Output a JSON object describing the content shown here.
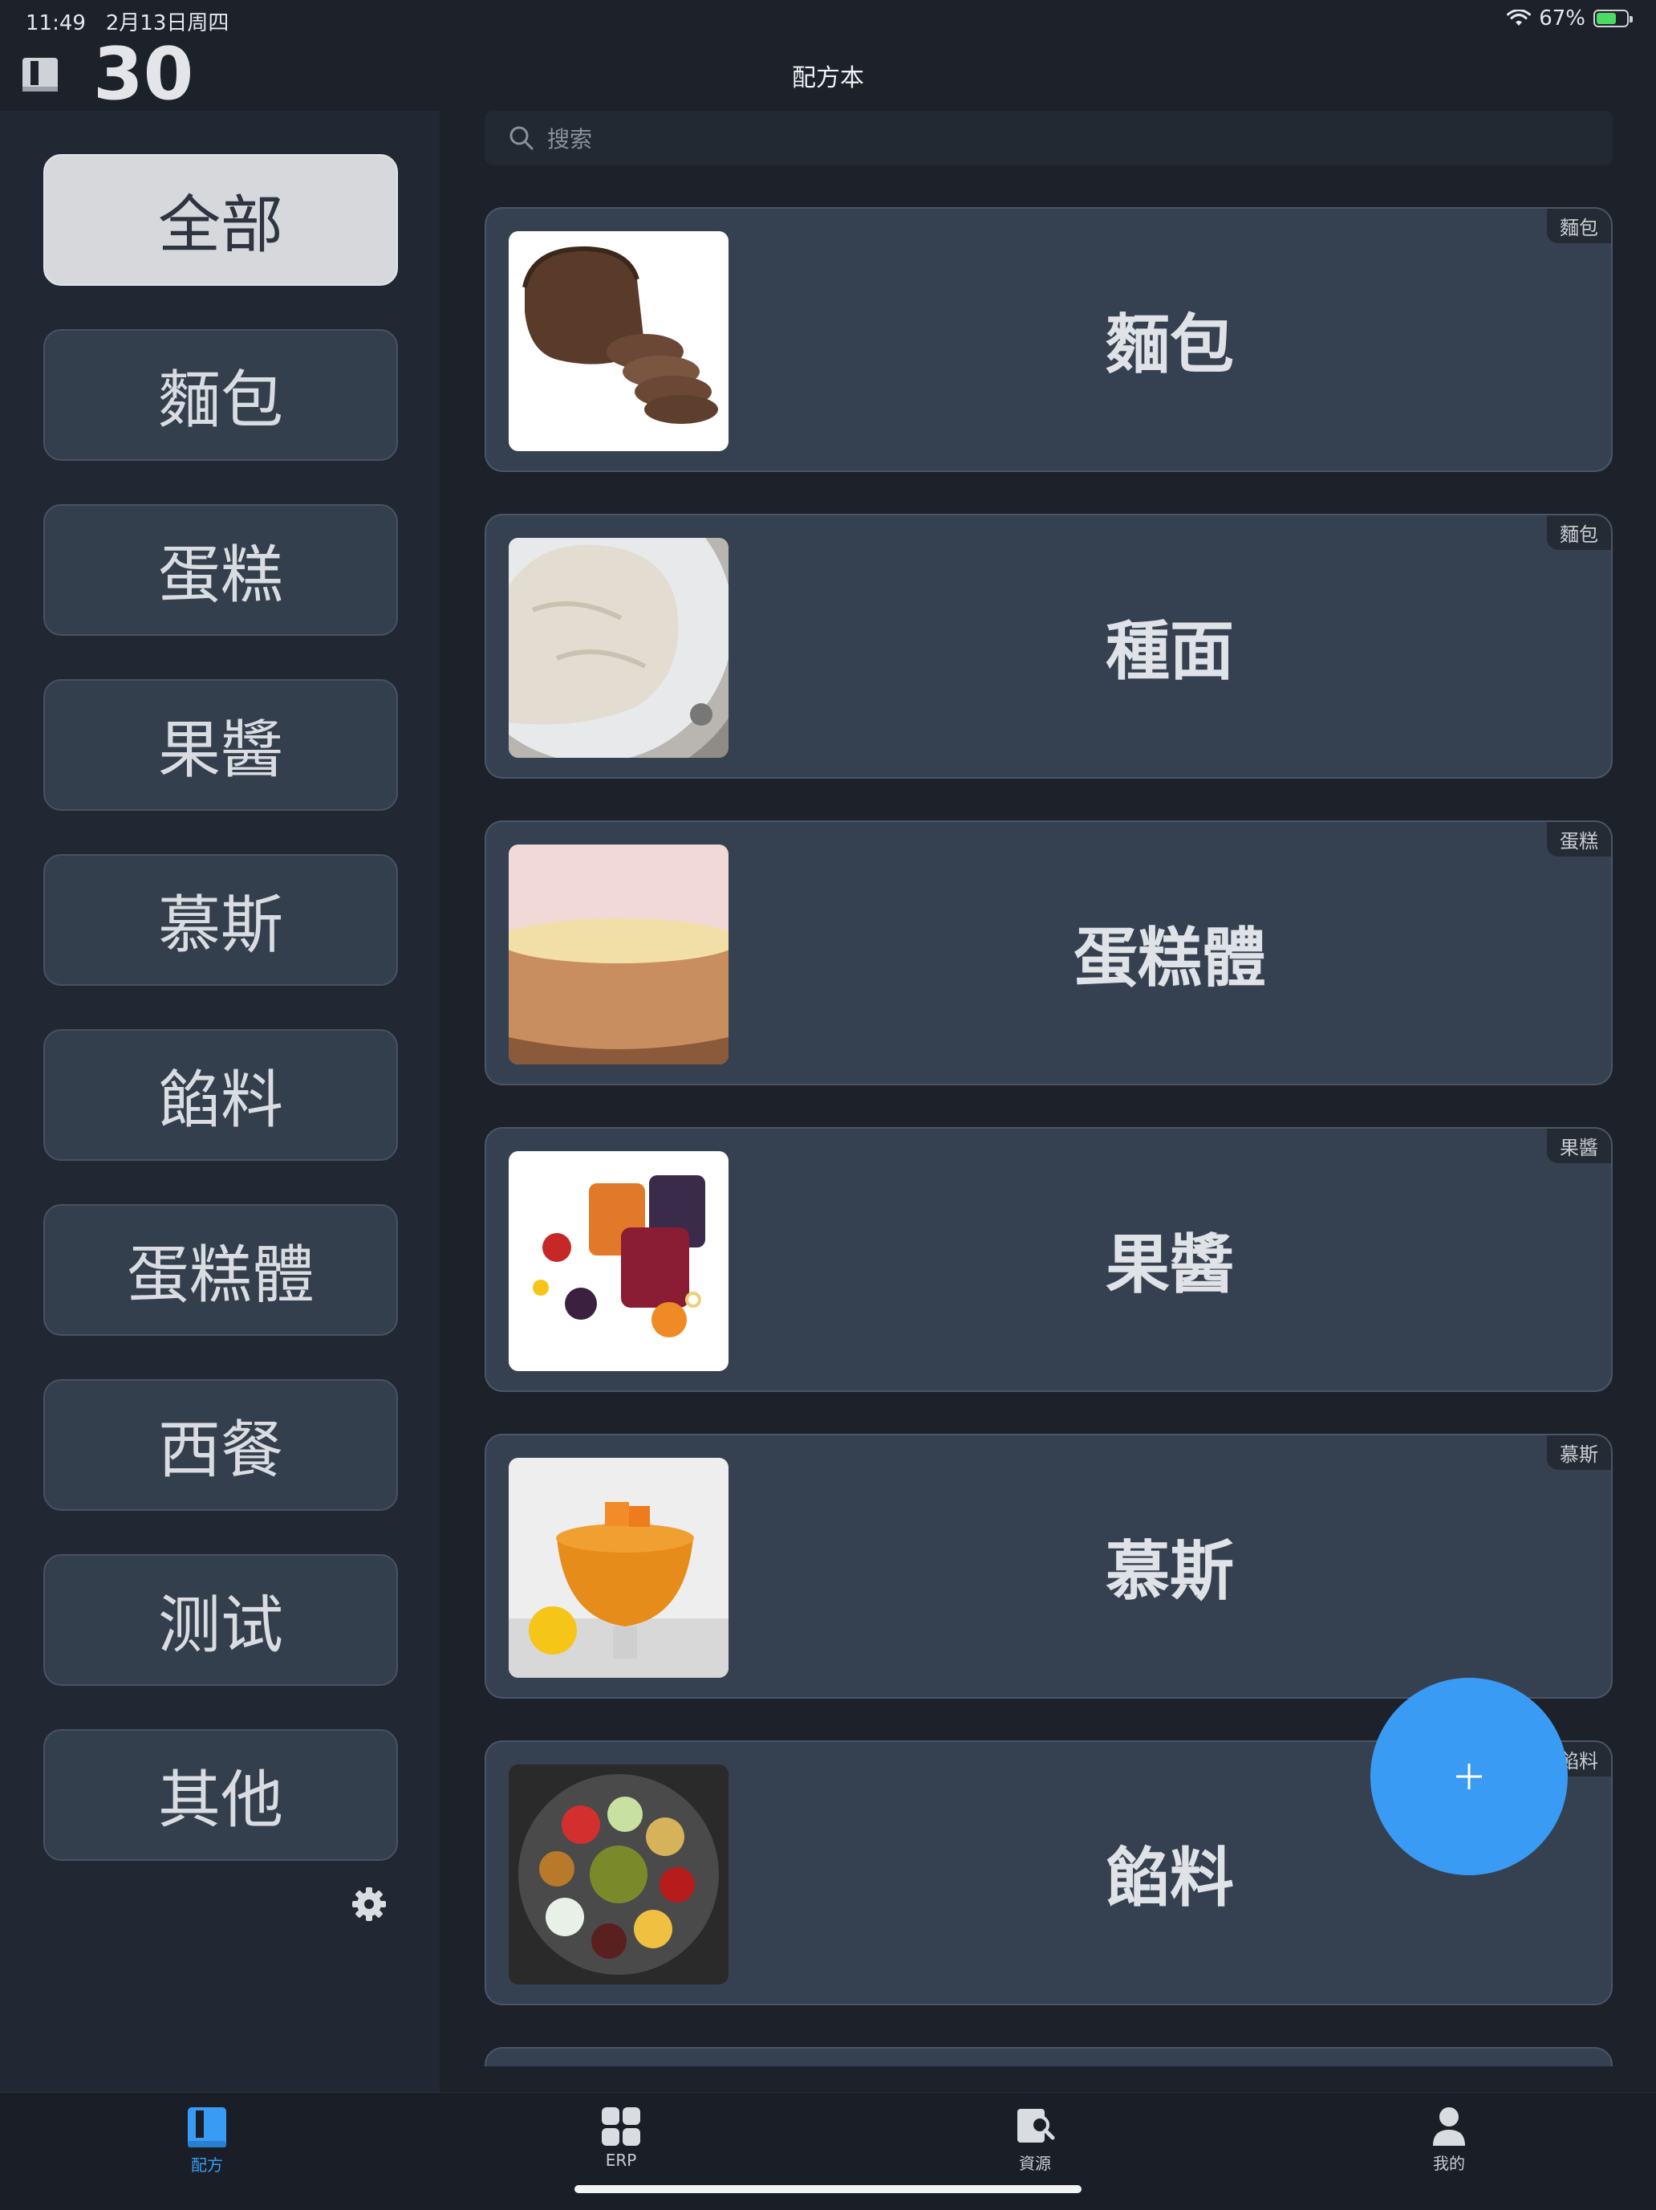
{
  "status_bar": {
    "time": "11:49",
    "date": "2月13日周四",
    "battery": "67%",
    "battery_level": 0.67
  },
  "header": {
    "count": "30",
    "title": "配方本"
  },
  "sidebar": {
    "categories": [
      "全部",
      "麵包",
      "蛋糕",
      "果醬",
      "慕斯",
      "餡料",
      "蛋糕體",
      "西餐",
      "测试",
      "其他"
    ],
    "active_index": 0
  },
  "search": {
    "placeholder": "搜索",
    "value": ""
  },
  "recipes": [
    {
      "title": "麵包",
      "tag": "麵包",
      "image": "bread-loaf"
    },
    {
      "title": "種面",
      "tag": "麵包",
      "image": "dough-bowl"
    },
    {
      "title": "蛋糕體",
      "tag": "蛋糕",
      "image": "sponge-cake"
    },
    {
      "title": "果醬",
      "tag": "果醬",
      "image": "jam-jars"
    },
    {
      "title": "慕斯",
      "tag": "慕斯",
      "image": "mango-mousse"
    },
    {
      "title": "餡料",
      "tag": "餡料",
      "image": "sauce-platter"
    }
  ],
  "fab": {
    "icon": "plus-icon"
  },
  "tabbar": {
    "items": [
      "配方",
      "ERP",
      "資源",
      "我的"
    ],
    "active_index": 0
  },
  "colors": {
    "accent": "#3a9bf4",
    "card": "#354150",
    "background": "#1c212a"
  }
}
